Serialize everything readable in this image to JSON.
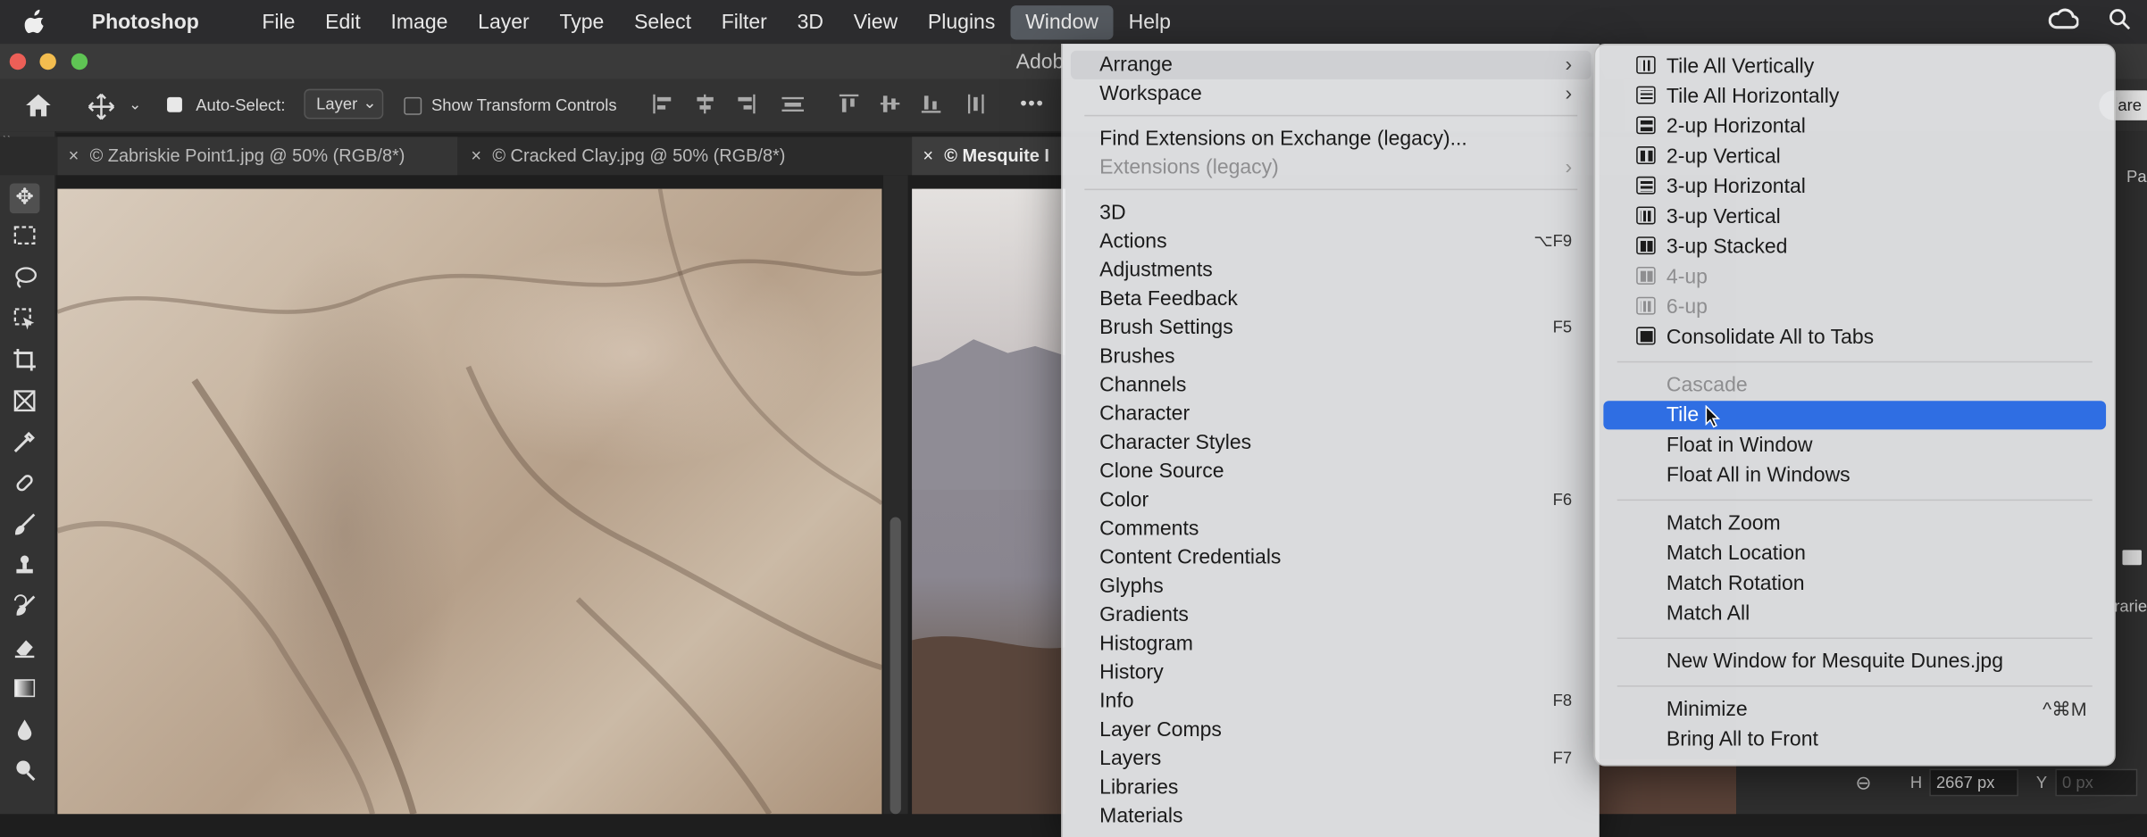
{
  "menubar": {
    "app_name": "Photoshop",
    "items": [
      "File",
      "Edit",
      "Image",
      "Layer",
      "Type",
      "Select",
      "Filter",
      "3D",
      "View",
      "Plugins",
      "Window",
      "Help"
    ]
  },
  "window": {
    "title": "Adob"
  },
  "options": {
    "auto_select_label": "Auto-Select:",
    "auto_select_value": "Layer",
    "show_transform_label": "Show Transform Controls",
    "more_label": "•••",
    "share_label": "are"
  },
  "tabs": [
    {
      "label": "© Zabriskie Point1.jpg @ 50% (RGB/8*)"
    },
    {
      "label": "© Cracked Clay.jpg @ 50% (RGB/8*)"
    },
    {
      "label": "© Mesquite I"
    }
  ],
  "right_panel": {
    "h_label": "H",
    "h_value": "2667 px",
    "y_label": "Y",
    "y_value": "0 px",
    "tab_fragment": "Pa",
    "lib_fragment": "rarie"
  },
  "window_menu": [
    {
      "label": "Arrange",
      "submenu": true,
      "highlight": true
    },
    {
      "label": "Workspace",
      "submenu": true
    },
    {
      "sep": true
    },
    {
      "label": "Find Extensions on Exchange (legacy)..."
    },
    {
      "label": "Extensions (legacy)",
      "submenu": true,
      "disabled": true
    },
    {
      "sep": true
    },
    {
      "label": "3D"
    },
    {
      "label": "Actions",
      "shortcut": "⌥F9"
    },
    {
      "label": "Adjustments"
    },
    {
      "label": "Beta Feedback"
    },
    {
      "label": "Brush Settings",
      "shortcut": "F5"
    },
    {
      "label": "Brushes"
    },
    {
      "label": "Channels"
    },
    {
      "label": "Character"
    },
    {
      "label": "Character Styles"
    },
    {
      "label": "Clone Source"
    },
    {
      "label": "Color",
      "shortcut": "F6"
    },
    {
      "label": "Comments"
    },
    {
      "label": "Content Credentials"
    },
    {
      "label": "Glyphs"
    },
    {
      "label": "Gradients"
    },
    {
      "label": "Histogram"
    },
    {
      "label": "History"
    },
    {
      "label": "Info",
      "shortcut": "F8"
    },
    {
      "label": "Layer Comps"
    },
    {
      "label": "Layers",
      "shortcut": "F7"
    },
    {
      "label": "Libraries"
    },
    {
      "label": "Materials"
    }
  ],
  "arrange_menu": [
    {
      "label": "Tile All Vertically",
      "icon": "tile-vertical-icon"
    },
    {
      "label": "Tile All Horizontally",
      "icon": "tile-horizontal-icon"
    },
    {
      "label": "2-up Horizontal",
      "icon": "two-up-horizontal-icon"
    },
    {
      "label": "2-up Vertical",
      "icon": "two-up-vertical-icon"
    },
    {
      "label": "3-up Horizontal",
      "icon": "three-up-horizontal-icon"
    },
    {
      "label": "3-up Vertical",
      "icon": "three-up-vertical-icon"
    },
    {
      "label": "3-up Stacked",
      "icon": "three-up-stacked-icon"
    },
    {
      "label": "4-up",
      "icon": "four-up-icon",
      "disabled": true
    },
    {
      "label": "6-up",
      "icon": "six-up-icon",
      "disabled": true
    },
    {
      "label": "Consolidate All to Tabs",
      "icon": "consolidate-icon"
    },
    {
      "sep": true
    },
    {
      "label": "Cascade",
      "disabled": true
    },
    {
      "label": "Tile",
      "selected": true
    },
    {
      "label": "Float in Window"
    },
    {
      "label": "Float All in Windows"
    },
    {
      "sep": true
    },
    {
      "label": "Match Zoom"
    },
    {
      "label": "Match Location"
    },
    {
      "label": "Match Rotation"
    },
    {
      "label": "Match All"
    },
    {
      "sep": true
    },
    {
      "label": "New Window for Mesquite Dunes.jpg"
    },
    {
      "sep": true
    },
    {
      "label": "Minimize",
      "shortcut": "^⌘M"
    },
    {
      "label": "Bring All to Front"
    }
  ],
  "colors": {
    "selection_blue": "#2f6ee3",
    "close_red": "#ec5f57",
    "minimize_yellow": "#f3bd4f",
    "zoom_green": "#5fc454"
  }
}
